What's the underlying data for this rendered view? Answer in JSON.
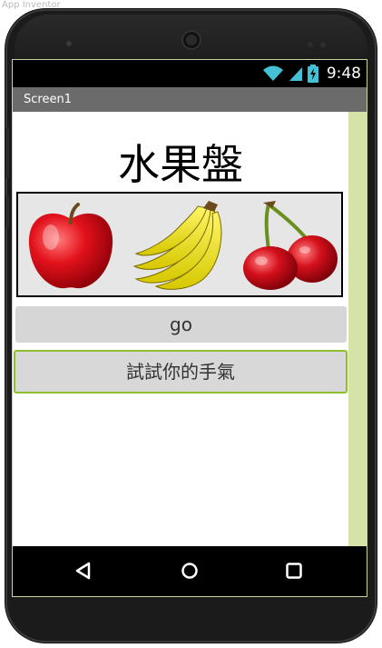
{
  "window": {
    "caption": "App Inventor"
  },
  "status_bar": {
    "time": "9:48",
    "icons": [
      "wifi-icon",
      "signal-icon",
      "battery-charging-icon"
    ]
  },
  "title_bar": {
    "title": "Screen1"
  },
  "main": {
    "heading": "水果盤",
    "fruits": [
      "apple-icon",
      "banana-icon",
      "cherry-icon"
    ],
    "go_button_label": "go",
    "luck_button_label": "試試你的手氣"
  },
  "nav_bar": {
    "icons": [
      "back-icon",
      "home-icon",
      "recents-icon"
    ]
  },
  "colors": {
    "screen_border": "#c6d6a3",
    "scroll_strip": "#d6e3a8",
    "luck_button_border": "#8fbf2f",
    "title_bar": "#6b6b6b"
  }
}
